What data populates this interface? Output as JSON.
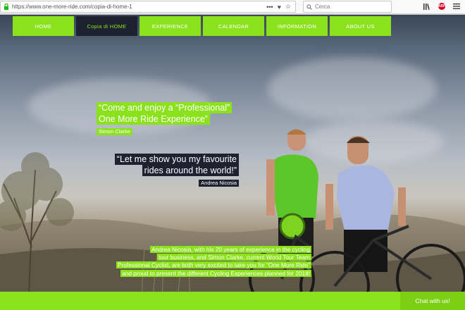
{
  "browser": {
    "url": "https://www.one-more-ride.com/copia-di-home-1",
    "url_actions": [
      "•••",
      "♥",
      "☆"
    ],
    "search_placeholder": "Cerca"
  },
  "nav": {
    "items": [
      {
        "label": "HOME"
      },
      {
        "label": "Copia di HOME"
      },
      {
        "label": "EXPERIENCE"
      },
      {
        "label": "CALENDAR"
      },
      {
        "label": "INFORMATION"
      },
      {
        "label": "ABOUT US"
      }
    ]
  },
  "quotes": {
    "first": {
      "line1": "“Come and enjoy a “Professional”",
      "line2": "One More Ride Experience”",
      "author": "Simon Clarke"
    },
    "second": {
      "line1": "“Let me show you my favourite",
      "line2": "rides around the world!”",
      "author": "Andrea Nicosia"
    }
  },
  "description": {
    "line1": "Andrea Nicosia, with his 20 years of experience in the cycling",
    "line2": "tour business, and Simon Clarke, current World Tour Team",
    "line3": "Professional Cyclist, are both very excited to take you for “One  More Ride”",
    "line4": "and proud to present the different Cycling  Experiences planned for 2018!"
  },
  "chat": {
    "label": "Chat with us!"
  },
  "colors": {
    "brand_green": "#8be21c",
    "dark_navy": "#1e2230"
  }
}
